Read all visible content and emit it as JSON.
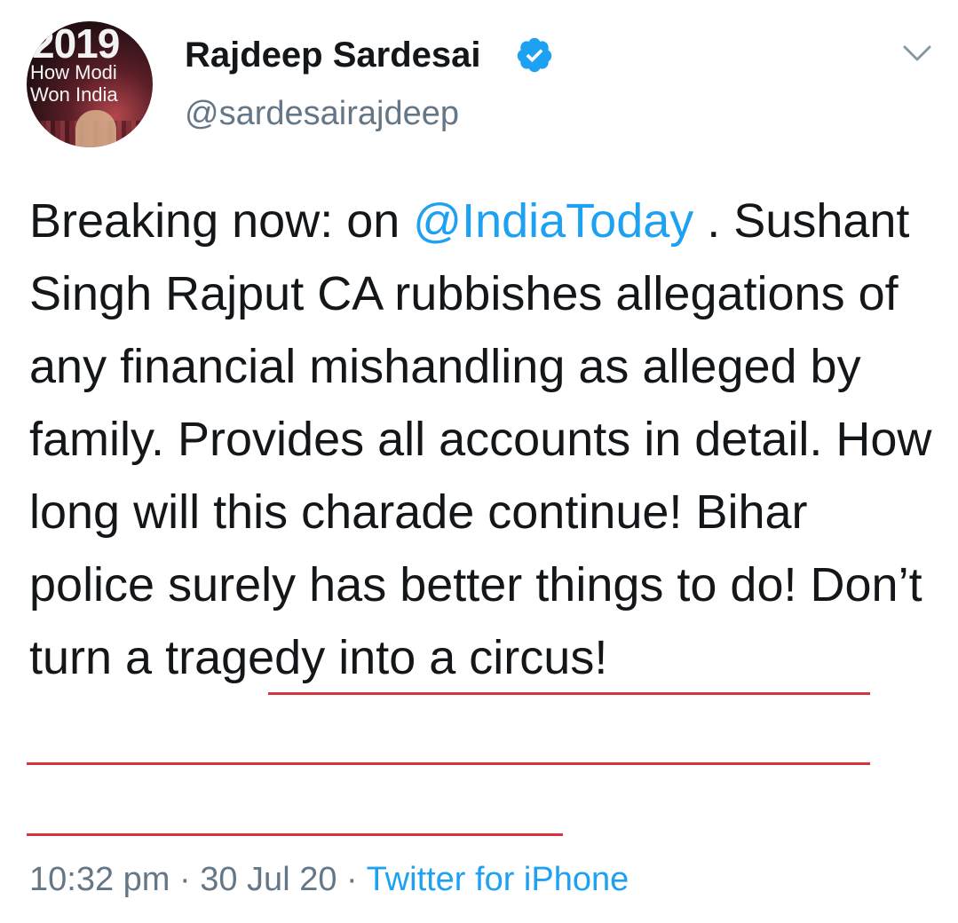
{
  "author": {
    "display_name": "Rajdeep Sardesai",
    "handle": "@sardesairajdeep",
    "verified": true,
    "avatar": {
      "year_text": "2019",
      "line1": "How Modi",
      "line2": "Won India"
    }
  },
  "tweet": {
    "part1": "Breaking now: on ",
    "mention": "@IndiaToday",
    "part2": " . Sushant Singh Rajput CA rubbishes allegations of any financial mishandling as alleged by family. Provides all accounts in detail. How long will this charade continue!",
    "highlighted": " Bihar police surely has better things to do! Don’t turn a tragedy into a circus!"
  },
  "meta": {
    "time": "10:32 pm",
    "separator": " · ",
    "date": "30 Jul 20",
    "source": "Twitter for iPhone"
  },
  "colors": {
    "link": "#1da1f2",
    "text": "#14171a",
    "secondary": "#657786",
    "underline": "#d6343f",
    "verified": "#1da1f2"
  },
  "icons": {
    "verified": "verified-badge-icon",
    "more": "chevron-down-icon"
  }
}
